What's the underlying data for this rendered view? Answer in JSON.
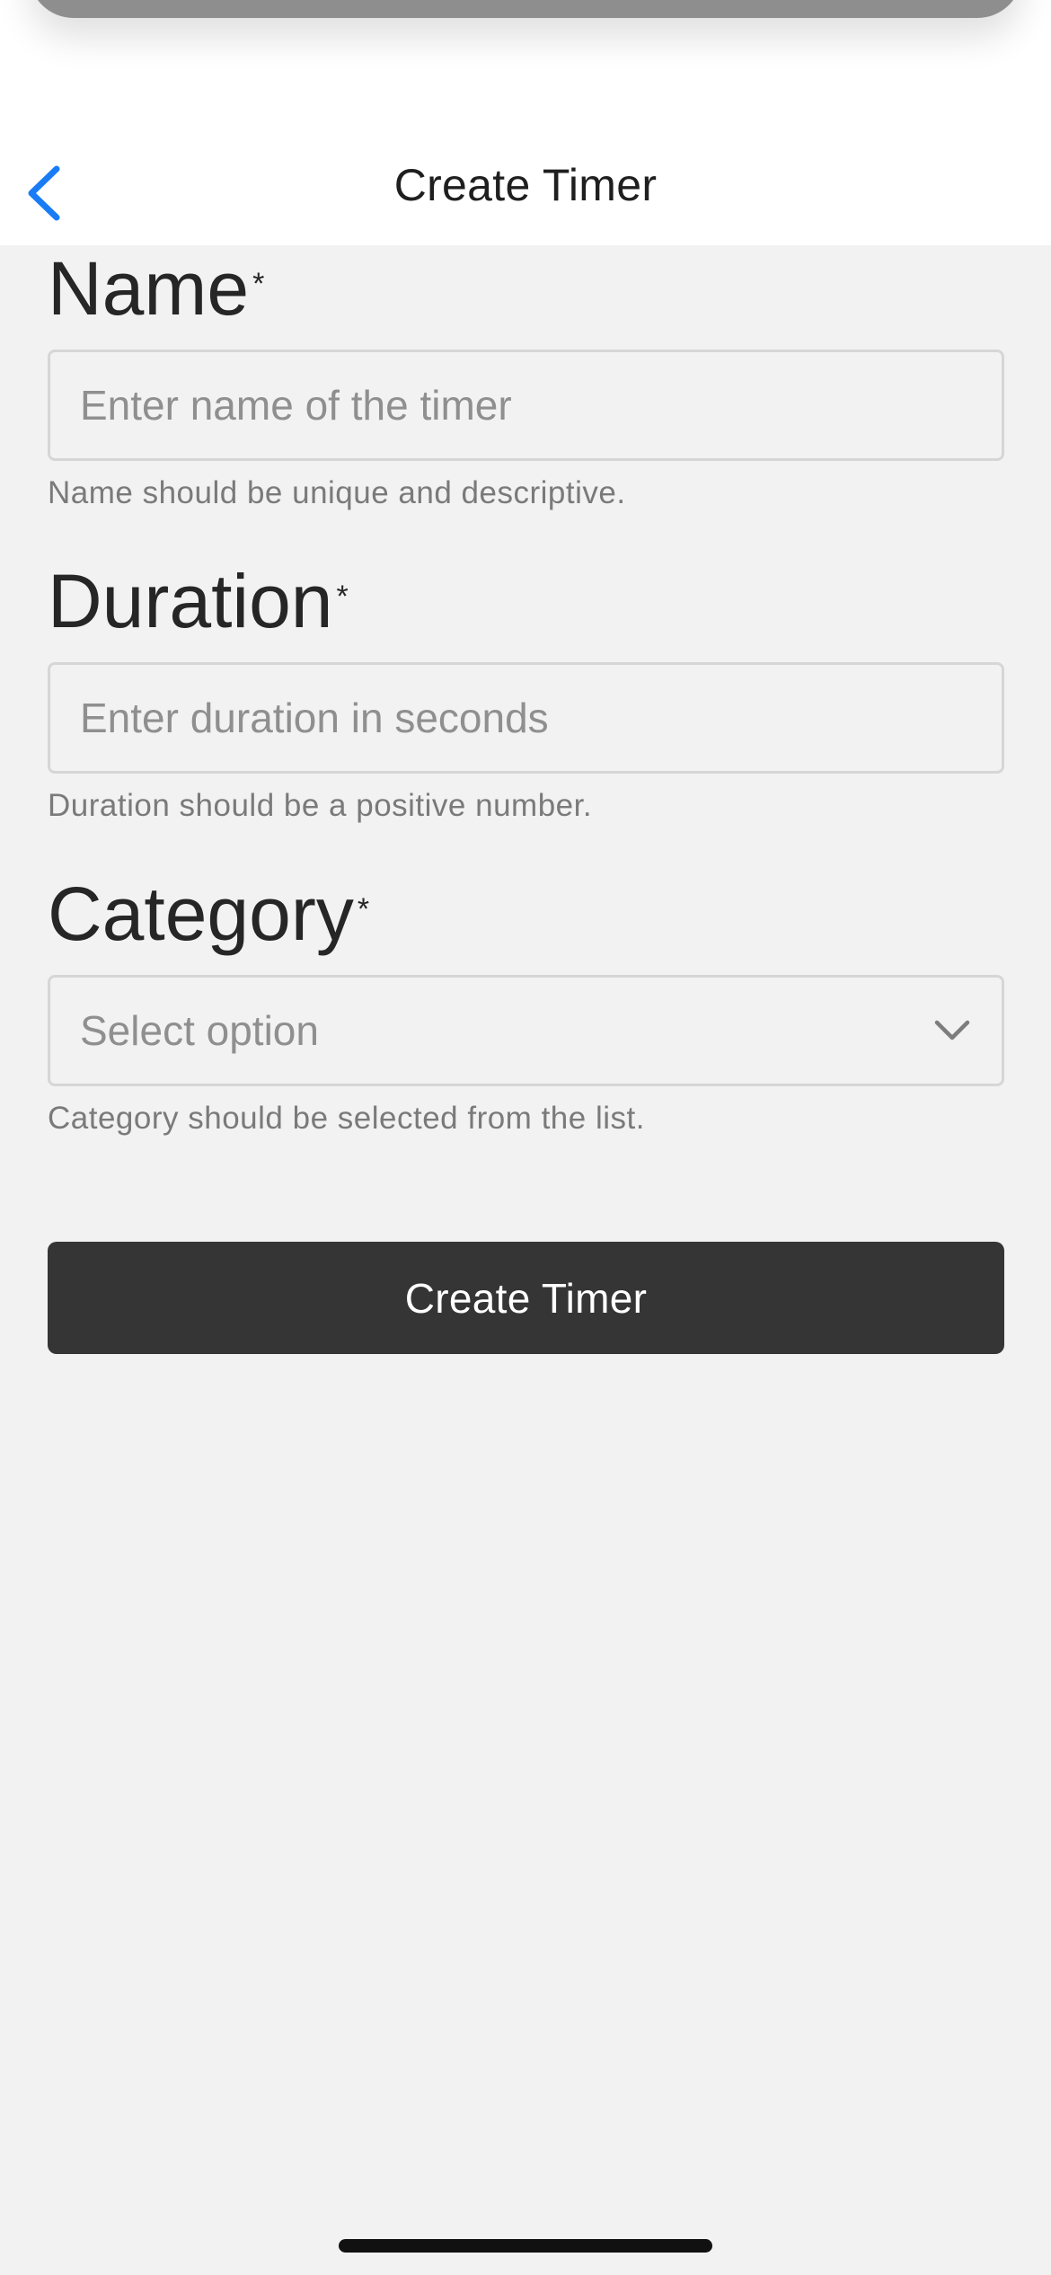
{
  "nav": {
    "title": "Create Timer"
  },
  "form": {
    "name": {
      "label": "Name",
      "required_mark": "*",
      "placeholder": "Enter name of the timer",
      "value": "",
      "helper": "Name should be unique and descriptive."
    },
    "duration": {
      "label": "Duration",
      "required_mark": "*",
      "placeholder": "Enter duration in seconds",
      "value": "",
      "helper": "Duration should be a positive number."
    },
    "category": {
      "label": "Category",
      "required_mark": "*",
      "selected": "Select option",
      "helper": "Category should be selected from the list."
    },
    "submit_label": "Create Timer"
  },
  "colors": {
    "accent": "#1a7cf5",
    "button_bg": "#353535",
    "background": "#f2f2f2"
  },
  "icons": {
    "back": "chevron-left-icon",
    "dropdown": "chevron-down-icon"
  }
}
